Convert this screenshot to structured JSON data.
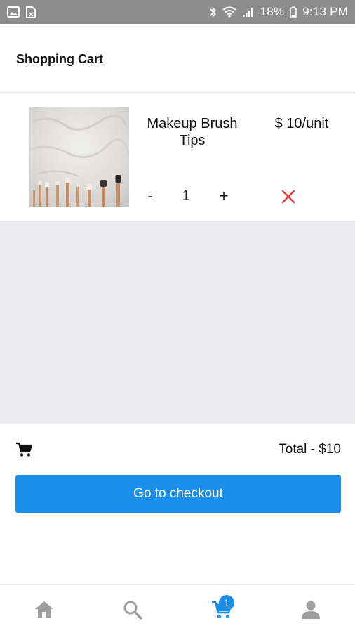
{
  "status_bar": {
    "battery": "18%",
    "time": "9:13 PM"
  },
  "header": {
    "title": "Shopping Cart"
  },
  "cart": {
    "items": [
      {
        "name": "Makeup Brush Tips",
        "price": "$ 10/unit",
        "quantity": "1",
        "minus_label": "-",
        "plus_label": "+",
        "image_icon": "makeup-brushes-photo"
      }
    ]
  },
  "summary": {
    "total": "Total - $10",
    "checkout_label": "Go to checkout"
  },
  "bottom_nav": {
    "cart_badge": "1",
    "items": [
      "home-icon",
      "search-icon",
      "cart-icon",
      "profile-icon"
    ]
  },
  "colors": {
    "accent": "#1a8ee9",
    "remove": "#e53935",
    "status_bar": "#8d8d8d",
    "content_bg": "#e9e9ee",
    "nav_inactive": "#9e9e9e"
  }
}
